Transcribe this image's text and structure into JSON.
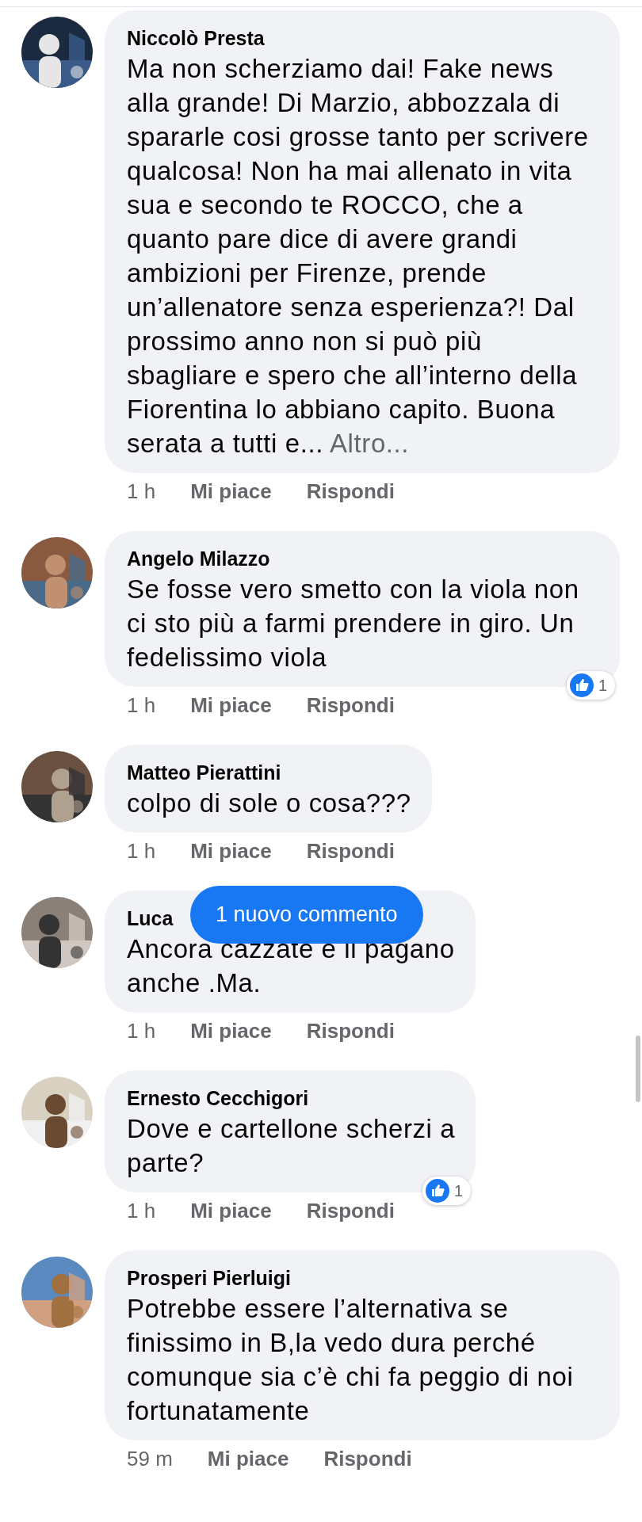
{
  "comments": [
    {
      "author": "Niccolò Presta",
      "text": "Ma non scherziamo dai! Fake news alla grande! Di Marzio, abbozzala di spararle cosi grosse tanto per scrivere qualcosa! Non ha mai allenato in vita sua e secondo te ROCCO, che a quanto pare dice di avere grandi ambizioni per Firenze, prende un’allenatore senza esperienza?! Dal prossimo anno non si può più sbagliare e spero che all’interno della Fiorentina lo abbiano capito. Buona serata a tutti e...",
      "more": "Altro...",
      "time": "1 h",
      "like": "Mi piace",
      "reply": "Rispondi"
    },
    {
      "author": "Angelo Milazzo",
      "text": "Se fosse vero smetto con la viola non ci sto più a farmi prendere in giro.  Un fedelissimo viola",
      "time": "1 h",
      "like": "Mi piace",
      "reply": "Rispondi",
      "reactions": "1"
    },
    {
      "author": "Matteo Pierattini",
      "text": "colpo di sole o cosa???",
      "time": "1 h",
      "like": "Mi piace",
      "reply": "Rispondi"
    },
    {
      "author": "Luca",
      "text": "Ancora cazzate e li pagano\nanche .Ma.",
      "time": "1 h",
      "like": "Mi piace",
      "reply": "Rispondi",
      "toast": "1 nuovo commento"
    },
    {
      "author": "Ernesto Cecchigori",
      "text": "Dove e cartellone scherzi a\nparte?",
      "time": "1 h",
      "like": "Mi piace",
      "reply": "Rispondi",
      "reactions": "1"
    },
    {
      "author": "Prosperi Pierluigi",
      "text": "Potrebbe essere l’alternativa se finissimo in B,la vedo dura perché comunque sia c’è chi fa peggio di noi fortunatamente",
      "time": "59 m",
      "like": "Mi piace",
      "reply": "Rispondi"
    }
  ]
}
